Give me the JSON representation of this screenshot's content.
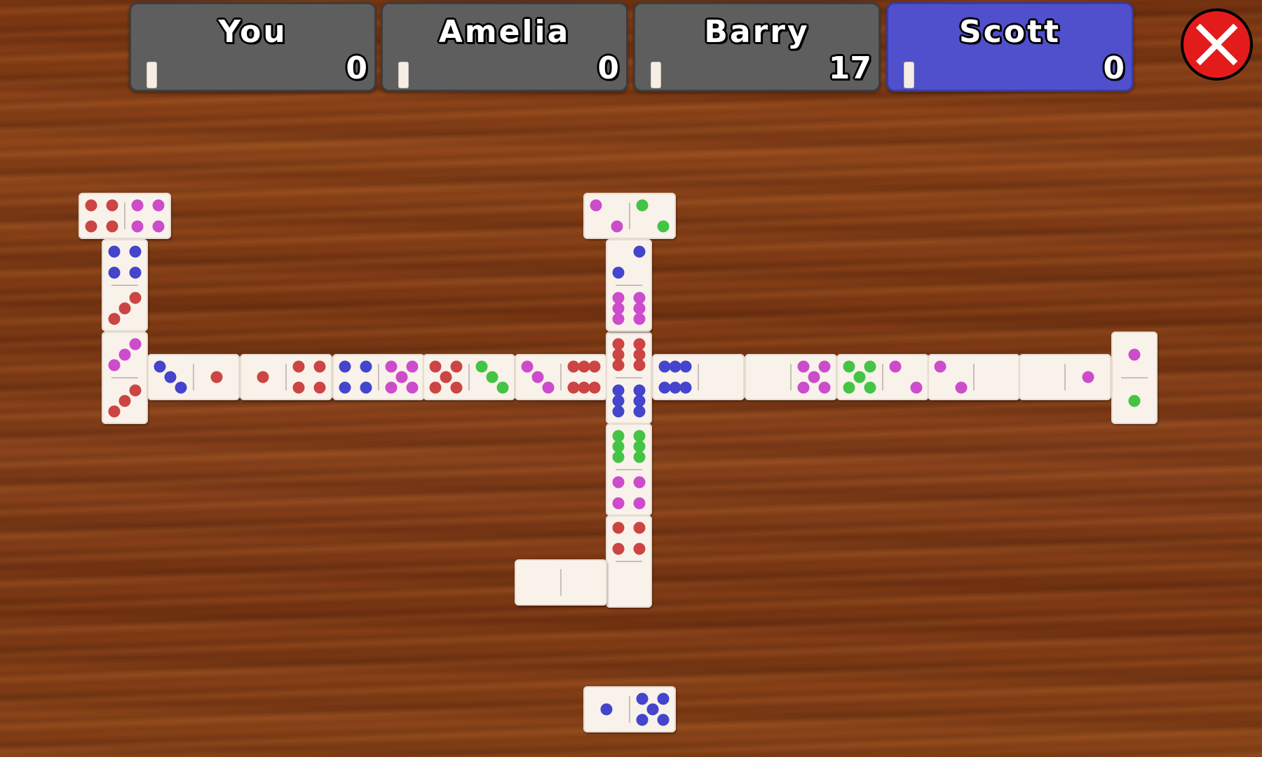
{
  "players": [
    {
      "name": "You",
      "score": "0",
      "active": false
    },
    {
      "name": "Amelia",
      "score": "0",
      "active": false
    },
    {
      "name": "Barry",
      "score": "17",
      "active": false
    },
    {
      "name": "Scott",
      "score": "0",
      "active": true
    }
  ],
  "colors": {
    "active_panel": "#5050cc",
    "inactive_panel": "#5e5e5e",
    "close_button": "#e41b1b",
    "pip_red": "#cc4444",
    "pip_magenta": "#cc4ccc",
    "pip_blue": "#4444cc",
    "pip_green": "#44c444"
  },
  "close_button": {
    "icon": "close-x-icon"
  },
  "board": [
    {
      "id": "tl-horizontal",
      "orientation": "horizontal",
      "a": 4,
      "a_color": "red",
      "b": 4,
      "b_color": "magenta"
    },
    {
      "id": "left-vertical-1",
      "orientation": "vertical",
      "a": 4,
      "a_color": "blue",
      "b": 3,
      "b_color": "red"
    },
    {
      "id": "left-vertical-2",
      "orientation": "vertical",
      "a": 3,
      "a_color": "magenta",
      "b": 3,
      "b_color": "red"
    },
    {
      "id": "row-1",
      "orientation": "horizontal",
      "a": 3,
      "a_color": "blue",
      "b": 1,
      "b_color": "red"
    },
    {
      "id": "row-2",
      "orientation": "horizontal",
      "a": 1,
      "a_color": "red",
      "b": 4,
      "b_color": "red"
    },
    {
      "id": "row-3",
      "orientation": "horizontal",
      "a": 4,
      "a_color": "blue",
      "b": 5,
      "b_color": "magenta"
    },
    {
      "id": "row-4",
      "orientation": "horizontal",
      "a": 5,
      "a_color": "red",
      "b": 3,
      "b_color": "green"
    },
    {
      "id": "row-5",
      "orientation": "horizontal",
      "a": 3,
      "a_color": "magenta",
      "b": 6,
      "b_color": "red"
    },
    {
      "id": "spinner",
      "orientation": "vertical",
      "a": 6,
      "a_color": "red",
      "b": 6,
      "b_color": "blue"
    },
    {
      "id": "row-6",
      "orientation": "horizontal",
      "a": 6,
      "a_color": "blue",
      "b": 0,
      "b_color": "none"
    },
    {
      "id": "row-7",
      "orientation": "horizontal",
      "a": 0,
      "a_color": "none",
      "b": 5,
      "b_color": "magenta"
    },
    {
      "id": "row-8",
      "orientation": "horizontal",
      "a": 5,
      "a_color": "green",
      "b": 2,
      "b_color": "magenta"
    },
    {
      "id": "row-9",
      "orientation": "horizontal",
      "a": 2,
      "a_color": "magenta",
      "b": 0,
      "b_color": "none"
    },
    {
      "id": "row-10",
      "orientation": "horizontal",
      "a": 0,
      "a_color": "none",
      "b": 1,
      "b_color": "magenta"
    },
    {
      "id": "right-end-vertical",
      "orientation": "vertical",
      "a": 1,
      "a_color": "magenta",
      "b": 1,
      "b_color": "green"
    },
    {
      "id": "top-horizontal",
      "orientation": "horizontal",
      "a": 2,
      "a_color": "magenta",
      "b": 2,
      "b_color": "green"
    },
    {
      "id": "up-vertical",
      "orientation": "vertical",
      "a": 2,
      "a_color": "blue",
      "b": 6,
      "b_color": "magenta"
    },
    {
      "id": "down-vertical-1",
      "orientation": "vertical",
      "a": 6,
      "a_color": "green",
      "b": 4,
      "b_color": "magenta"
    },
    {
      "id": "down-vertical-2",
      "orientation": "vertical",
      "a": 4,
      "a_color": "red",
      "b": 0,
      "b_color": "none"
    },
    {
      "id": "bottom-horizontal",
      "orientation": "horizontal",
      "a": 0,
      "a_color": "none",
      "b": 0,
      "b_color": "none"
    }
  ],
  "hand": [
    {
      "id": "hand-tile-1",
      "orientation": "horizontal",
      "a": 1,
      "a_color": "blue",
      "b": 5,
      "b_color": "blue"
    }
  ]
}
